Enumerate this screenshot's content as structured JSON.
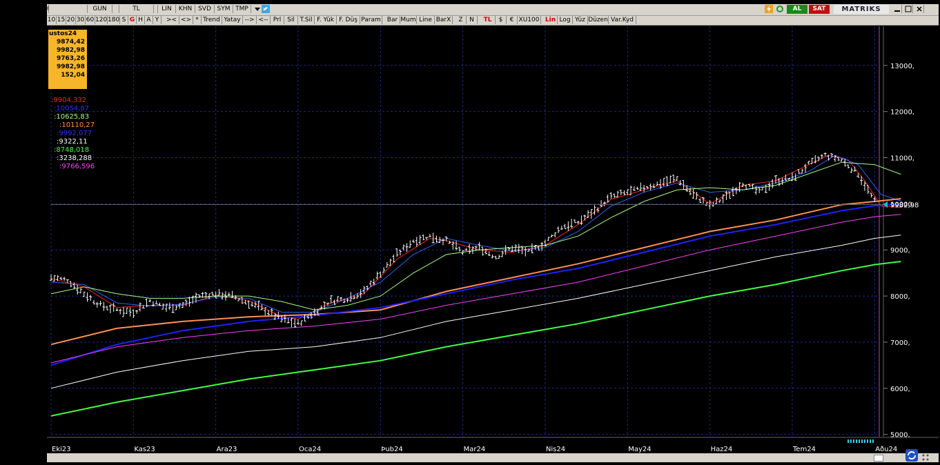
{
  "toolbar": {
    "row1": [
      {
        "label": "00",
        "w": 3
      },
      {
        "label": "",
        "w": 56
      },
      {
        "label": "GUN",
        "w": 36
      },
      {
        "label": "",
        "w": 10
      },
      {
        "label": "TL",
        "w": 50
      },
      {
        "label": "",
        "w": 6
      },
      {
        "label": "LIN",
        "w": 26
      },
      {
        "label": "KHN",
        "w": 28
      },
      {
        "label": "SVD",
        "w": 28
      },
      {
        "label": "SYM",
        "w": 27
      },
      {
        "label": "TMP",
        "w": 26
      }
    ],
    "row2": [
      {
        "label": "10"
      },
      {
        "label": "15"
      },
      {
        "label": "20"
      },
      {
        "label": "30"
      },
      {
        "label": "60"
      },
      {
        "label": "120"
      },
      {
        "label": "180"
      },
      {
        "label": "S"
      },
      {
        "label": "G",
        "red": true
      },
      {
        "label": "H"
      },
      {
        "label": "A"
      },
      {
        "label": "Y"
      },
      {
        "label": "><"
      },
      {
        "label": "<>"
      },
      {
        "label": "*"
      },
      {
        "label": "Trend"
      },
      {
        "label": "Yatay"
      },
      {
        "label": "-->"
      },
      {
        "label": "<--"
      },
      {
        "label": "Prl"
      },
      {
        "label": "Sil"
      },
      {
        "label": "T.Sil"
      },
      {
        "label": "F. Yük"
      },
      {
        "label": "F. Düş"
      },
      {
        "label": "Param"
      },
      {
        "label": "Bar"
      },
      {
        "label": "Mum"
      },
      {
        "label": "Line"
      },
      {
        "label": "BarX"
      },
      {
        "label": "Z"
      },
      {
        "label": "N"
      },
      {
        "label": "TL",
        "red": true
      },
      {
        "label": "$"
      },
      {
        "label": "€"
      },
      {
        "label": "XU100"
      },
      {
        "label": "Lin",
        "red": true
      },
      {
        "label": "Log"
      },
      {
        "label": "Yüz"
      },
      {
        "label": "Düzen"
      },
      {
        "label": "Var.Kyd"
      }
    ],
    "al_label": "AL",
    "sat_label": "SAT",
    "brand": "MATRIKS"
  },
  "info_box": {
    "header": "ustos24",
    "values": [
      "9874,42",
      "9982,98",
      "9763,26",
      "9982,98",
      "",
      "152,04"
    ]
  },
  "legend": [
    {
      "text": ":9904,332",
      "color": "#ff2020"
    },
    {
      "text": ":10054,87",
      "color": "#3030ff"
    },
    {
      "text": ":10625,83",
      "color": "#a8ff80"
    },
    {
      "text": ":10110,27",
      "color": "#ff9050"
    },
    {
      "text": ":9992,077",
      "color": "#3030ff"
    },
    {
      "text": ":9322,11",
      "color": "#ffffff"
    },
    {
      "text": ":8748,018",
      "color": "#40ff40"
    },
    {
      "text": ":3238,288",
      "color": "#ffffff"
    },
    {
      "text": ":9766,596",
      "color": "#ff40ff"
    }
  ],
  "chart_data": {
    "type": "line",
    "y_ticks": [
      "13000,",
      "12000,",
      "11000,",
      "10000,",
      "9000,",
      "8000,",
      "7000,",
      "6000,",
      "5000,"
    ],
    "y_tick_values": [
      13000,
      12000,
      11000,
      10000,
      9000,
      8000,
      7000,
      6000,
      5000
    ],
    "ylim": [
      4950,
      13850
    ],
    "current_label": "9982,98",
    "current_value": 9982.98,
    "x_ticks": [
      "Eki23",
      "Kas23",
      "Ara23",
      "Oca24",
      "Þub24",
      "Mar24",
      "Nis24",
      "May24",
      "Haz24",
      "Tem24",
      "Aðu24"
    ],
    "x_tick_positions": [
      0,
      25,
      50,
      75,
      100,
      125,
      150,
      175,
      200,
      225,
      250
    ],
    "n_bars": 251,
    "grid": true,
    "price_path": [
      [
        0,
        8400
      ],
      [
        5,
        8350
      ],
      [
        10,
        8050
      ],
      [
        15,
        7800
      ],
      [
        20,
        7700
      ],
      [
        25,
        7650
      ],
      [
        30,
        7900
      ],
      [
        35,
        7750
      ],
      [
        40,
        7800
      ],
      [
        45,
        8000
      ],
      [
        50,
        8050
      ],
      [
        55,
        8000
      ],
      [
        60,
        7850
      ],
      [
        65,
        7700
      ],
      [
        70,
        7500
      ],
      [
        75,
        7400
      ],
      [
        80,
        7650
      ],
      [
        85,
        7900
      ],
      [
        90,
        7950
      ],
      [
        95,
        8100
      ],
      [
        100,
        8500
      ],
      [
        105,
        8900
      ],
      [
        110,
        9200
      ],
      [
        115,
        9300
      ],
      [
        120,
        9200
      ],
      [
        125,
        8950
      ],
      [
        130,
        9050
      ],
      [
        135,
        8850
      ],
      [
        140,
        9050
      ],
      [
        145,
        8950
      ],
      [
        150,
        9150
      ],
      [
        155,
        9500
      ],
      [
        160,
        9600
      ],
      [
        165,
        9850
      ],
      [
        170,
        10150
      ],
      [
        175,
        10250
      ],
      [
        180,
        10350
      ],
      [
        185,
        10450
      ],
      [
        190,
        10550
      ],
      [
        195,
        10200
      ],
      [
        200,
        9950
      ],
      [
        205,
        10150
      ],
      [
        210,
        10450
      ],
      [
        215,
        10250
      ],
      [
        220,
        10500
      ],
      [
        225,
        10550
      ],
      [
        230,
        10850
      ],
      [
        235,
        11050
      ],
      [
        240,
        10950
      ],
      [
        245,
        10650
      ],
      [
        250,
        10050
      ],
      [
        255,
        9900
      ]
    ],
    "series": [
      {
        "name": "",
        "color": "#ff2020",
        "width": 1,
        "points": [
          [
            0,
            8380
          ],
          [
            10,
            8200
          ],
          [
            20,
            7750
          ],
          [
            30,
            7800
          ],
          [
            40,
            7800
          ],
          [
            50,
            8020
          ],
          [
            60,
            7900
          ],
          [
            70,
            7550
          ],
          [
            75,
            7500
          ],
          [
            85,
            7850
          ],
          [
            95,
            8050
          ],
          [
            105,
            8800
          ],
          [
            115,
            9250
          ],
          [
            120,
            9200
          ],
          [
            130,
            9000
          ],
          [
            140,
            8950
          ],
          [
            150,
            9100
          ],
          [
            160,
            9550
          ],
          [
            170,
            10100
          ],
          [
            180,
            10300
          ],
          [
            190,
            10500
          ],
          [
            200,
            10000
          ],
          [
            210,
            10400
          ],
          [
            220,
            10500
          ],
          [
            230,
            10850
          ],
          [
            236,
            11050
          ],
          [
            242,
            10950
          ],
          [
            247,
            10500
          ],
          [
            252,
            9950
          ],
          [
            258,
            9920
          ]
        ]
      },
      {
        "name": "",
        "color": "#3060ff",
        "width": 1,
        "points": [
          [
            0,
            8300
          ],
          [
            10,
            8250
          ],
          [
            20,
            7850
          ],
          [
            30,
            7780
          ],
          [
            40,
            7820
          ],
          [
            50,
            7980
          ],
          [
            60,
            7950
          ],
          [
            70,
            7650
          ],
          [
            80,
            7650
          ],
          [
            90,
            7950
          ],
          [
            100,
            8300
          ],
          [
            110,
            8900
          ],
          [
            120,
            9250
          ],
          [
            130,
            9100
          ],
          [
            140,
            8980
          ],
          [
            150,
            9050
          ],
          [
            160,
            9400
          ],
          [
            170,
            9950
          ],
          [
            180,
            10250
          ],
          [
            190,
            10450
          ],
          [
            200,
            10250
          ],
          [
            210,
            10300
          ],
          [
            220,
            10450
          ],
          [
            230,
            10700
          ],
          [
            238,
            11050
          ],
          [
            245,
            10850
          ],
          [
            252,
            10200
          ],
          [
            258,
            10060
          ]
        ]
      },
      {
        "name": "",
        "color": "#a8ff80",
        "width": 1,
        "points": [
          [
            0,
            8050
          ],
          [
            10,
            8200
          ],
          [
            20,
            8050
          ],
          [
            30,
            7950
          ],
          [
            40,
            7950
          ],
          [
            50,
            8000
          ],
          [
            60,
            8000
          ],
          [
            70,
            7880
          ],
          [
            80,
            7700
          ],
          [
            90,
            7800
          ],
          [
            100,
            8000
          ],
          [
            110,
            8500
          ],
          [
            120,
            8900
          ],
          [
            130,
            9000
          ],
          [
            140,
            9050
          ],
          [
            150,
            9100
          ],
          [
            160,
            9300
          ],
          [
            170,
            9700
          ],
          [
            180,
            10050
          ],
          [
            190,
            10300
          ],
          [
            200,
            10350
          ],
          [
            210,
            10300
          ],
          [
            220,
            10400
          ],
          [
            230,
            10650
          ],
          [
            240,
            10900
          ],
          [
            250,
            10850
          ],
          [
            258,
            10640
          ]
        ]
      },
      {
        "name": "",
        "color": "#ff9050",
        "width": 2,
        "points": [
          [
            0,
            6950
          ],
          [
            20,
            7300
          ],
          [
            40,
            7450
          ],
          [
            60,
            7550
          ],
          [
            80,
            7600
          ],
          [
            100,
            7700
          ],
          [
            120,
            8100
          ],
          [
            140,
            8400
          ],
          [
            160,
            8700
          ],
          [
            180,
            9050
          ],
          [
            200,
            9400
          ],
          [
            220,
            9650
          ],
          [
            240,
            9980
          ],
          [
            250,
            10050
          ],
          [
            258,
            10110
          ]
        ]
      },
      {
        "name": "",
        "color": "#2020ff",
        "width": 2,
        "points": [
          [
            0,
            6500
          ],
          [
            20,
            6950
          ],
          [
            40,
            7250
          ],
          [
            60,
            7450
          ],
          [
            80,
            7580
          ],
          [
            100,
            7750
          ],
          [
            120,
            8050
          ],
          [
            140,
            8350
          ],
          [
            160,
            8600
          ],
          [
            180,
            8950
          ],
          [
            200,
            9300
          ],
          [
            220,
            9550
          ],
          [
            240,
            9850
          ],
          [
            250,
            9960
          ],
          [
            258,
            9990
          ]
        ]
      },
      {
        "name": "",
        "color": "#ff40ff",
        "width": 1,
        "points": [
          [
            0,
            6550
          ],
          [
            20,
            6900
          ],
          [
            40,
            7100
          ],
          [
            60,
            7250
          ],
          [
            80,
            7350
          ],
          [
            100,
            7500
          ],
          [
            120,
            7800
          ],
          [
            140,
            8050
          ],
          [
            160,
            8300
          ],
          [
            180,
            8650
          ],
          [
            200,
            9000
          ],
          [
            220,
            9300
          ],
          [
            240,
            9600
          ],
          [
            250,
            9720
          ],
          [
            258,
            9770
          ]
        ]
      },
      {
        "name": "",
        "color": "#ffffff",
        "width": 1,
        "points": [
          [
            0,
            6000
          ],
          [
            20,
            6350
          ],
          [
            40,
            6600
          ],
          [
            60,
            6800
          ],
          [
            80,
            6900
          ],
          [
            100,
            7100
          ],
          [
            120,
            7450
          ],
          [
            140,
            7700
          ],
          [
            160,
            7950
          ],
          [
            180,
            8250
          ],
          [
            200,
            8550
          ],
          [
            220,
            8850
          ],
          [
            240,
            9100
          ],
          [
            250,
            9250
          ],
          [
            258,
            9320
          ]
        ]
      },
      {
        "name": "",
        "color": "#40ff40",
        "width": 2,
        "points": [
          [
            0,
            5400
          ],
          [
            20,
            5700
          ],
          [
            40,
            5950
          ],
          [
            60,
            6200
          ],
          [
            80,
            6400
          ],
          [
            100,
            6600
          ],
          [
            120,
            6900
          ],
          [
            140,
            7150
          ],
          [
            160,
            7400
          ],
          [
            180,
            7700
          ],
          [
            200,
            8000
          ],
          [
            220,
            8250
          ],
          [
            240,
            8550
          ],
          [
            250,
            8680
          ],
          [
            258,
            8750
          ]
        ]
      }
    ]
  }
}
